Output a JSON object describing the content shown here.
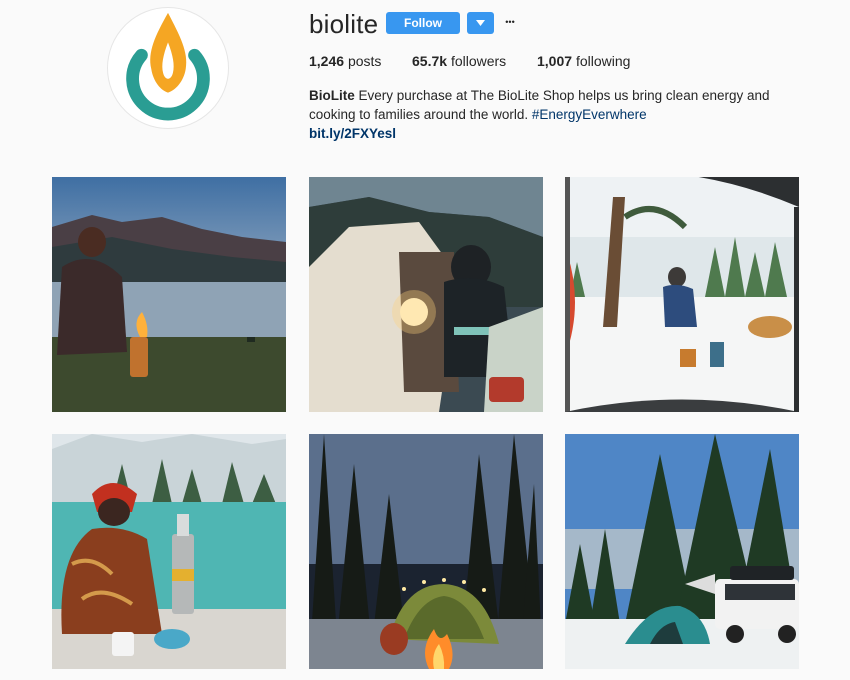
{
  "profile": {
    "username": "biolite",
    "follow_label": "Follow",
    "more_glyph": "•••",
    "dropdown_icon": "chevron-down-icon"
  },
  "stats": {
    "posts_count": "1,246",
    "posts_label": "posts",
    "followers_count": "65.7k",
    "followers_label": "followers",
    "following_count": "1,007",
    "following_label": "following"
  },
  "bio": {
    "name": "BioLite",
    "text_line1": " Every purchase at The BioLite Shop helps us bring clean energy and",
    "text_line2": "cooking to families around the world. ",
    "hashtag": "#EnergyEverwhere",
    "link": "bit.ly/2FXYesl"
  },
  "colors": {
    "accent_blue": "#3897f0",
    "link_blue": "#003569",
    "logo_orange": "#f5a623",
    "logo_teal": "#2a9d93"
  },
  "posts": [
    {
      "subject": "person seated by lake with campfire stove at dusk"
    },
    {
      "subject": "person in tent with lantern at night in mountains"
    },
    {
      "subject": "person and dog at campsite in snow seen from tent"
    },
    {
      "subject": "person in red hat cooking by turquoise mountain lake"
    },
    {
      "subject": "lit tent and campfire under forest at night"
    },
    {
      "subject": "tent and van camping in snowy pine forest"
    }
  ]
}
